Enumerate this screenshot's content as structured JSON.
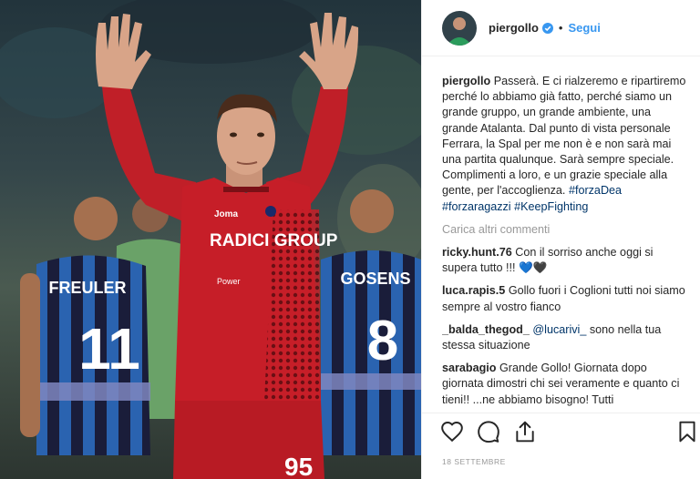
{
  "post": {
    "username": "piergollo",
    "follow_label": "Segui",
    "separator": "•",
    "date": "18 SETTEMBRE",
    "accent_color": "#3897f0"
  },
  "photo": {
    "description_icon": "goalkeeper-photo",
    "left_player_name": "FREULER",
    "left_player_number": "11",
    "right_player_name": "GOSENS",
    "right_player_number": "8",
    "main_player_number": "95",
    "sponsor": "RADICI GROUP",
    "kit_brand": "Joma",
    "sleeve_sponsor": "Power"
  },
  "caption": {
    "username": "piergollo",
    "text": "Passerà. E ci rialzeremo e ripartiremo perché lo abbiamo già fatto, perché siamo un grande gruppo, un grande ambiente, una grande Atalanta. Dal punto di vista personale Ferrara, la Spal per me non è e non sarà mai una partita qualunque. Sarà sempre speciale. Complimenti a loro, e un grazie speciale alla gente, per l'accoglienza.",
    "hashtags": [
      "#forzaDea",
      "#forzaragazzi",
      "#KeepFighting"
    ]
  },
  "load_more_label": "Carica altri commenti",
  "comments": [
    {
      "username": "ricky.hunt.76",
      "text": "Con il sorriso anche oggi si supera tutto !!!",
      "hearts": [
        "💙",
        "🖤"
      ]
    },
    {
      "username": "luca.rapis.5",
      "text": "Gollo fuori i Coglioni tutti noi siamo sempre al vostro fianco"
    },
    {
      "username": "_balda_thegod_",
      "mention": "@lucarivi_",
      "text": "sono nella tua stessa situazione"
    },
    {
      "username": "sarabagio",
      "text": "Grande Gollo! Giornata dopo giornata dimostri chi sei veramente e quanto ci tieni!! ...ne abbiamo bisogno! Tutti"
    }
  ],
  "icons": {
    "like": "heart-outline-icon",
    "comment": "comment-bubble-icon",
    "share": "share-icon",
    "save": "bookmark-icon",
    "verified": "verified-badge-icon"
  }
}
